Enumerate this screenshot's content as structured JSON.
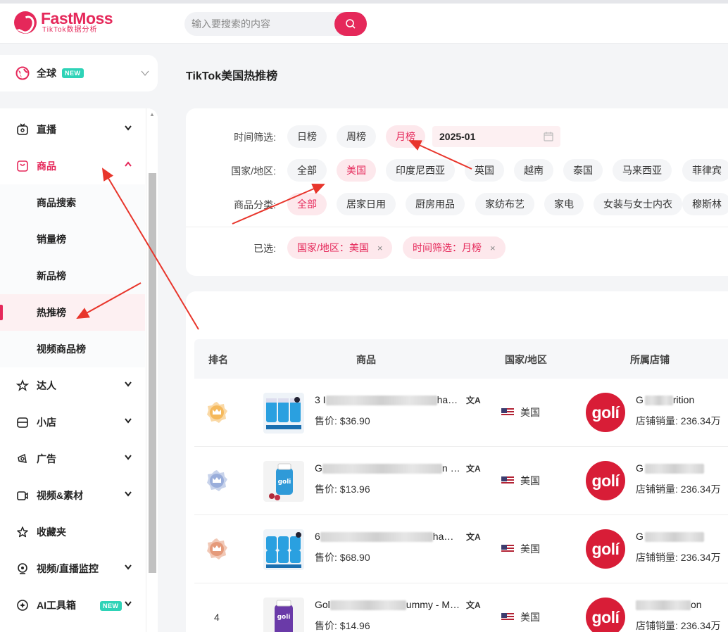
{
  "header": {
    "logo_name": "FastMoss",
    "logo_sub": "TikTok数据分析",
    "search_placeholder": "输入要搜索的内容"
  },
  "region_selector": {
    "label": "全球",
    "badge": "NEW"
  },
  "sidebar": {
    "items": [
      {
        "label": "直播",
        "icon": "live-icon"
      },
      {
        "label": "商品",
        "icon": "product-icon"
      },
      {
        "label": "达人",
        "icon": "influencer-icon"
      },
      {
        "label": "小店",
        "icon": "shop-icon"
      },
      {
        "label": "广告",
        "icon": "ad-icon"
      },
      {
        "label": "视频&素材",
        "icon": "video-icon"
      },
      {
        "label": "收藏夹",
        "icon": "star-icon"
      },
      {
        "label": "视频/直播监控",
        "icon": "monitor-icon"
      },
      {
        "label": "AI工具箱",
        "icon": "ai-icon",
        "badge": "NEW"
      }
    ],
    "sub_items": [
      "商品搜索",
      "销量榜",
      "新品榜",
      "热推榜",
      "视频商品榜"
    ]
  },
  "page_title": "TikTok美国热推榜",
  "filters": {
    "time_label": "时间筛选:",
    "time_options": [
      "日榜",
      "周榜",
      "月榜"
    ],
    "date_value": "2025-01",
    "country_label": "国家/地区:",
    "country_options": [
      "全部",
      "美国",
      "印度尼西亚",
      "英国",
      "越南",
      "泰国",
      "马来西亚",
      "菲律宾"
    ],
    "category_label": "商品分类:",
    "category_options": [
      "全部",
      "居家日用",
      "厨房用品",
      "家纺布艺",
      "家电",
      "女装与女士内衣",
      "穆斯林"
    ],
    "selected_label": "已选:",
    "selected": [
      "国家/地区：美国",
      "时间筛选：月榜"
    ],
    "remove_symbol": "×"
  },
  "table": {
    "headers": {
      "rank": "排名",
      "product": "商品",
      "country": "国家/地区",
      "shop": "所属店铺"
    },
    "price_label": "售价:",
    "sales_label": "店铺销量:",
    "rows": [
      {
        "rank": "1",
        "name_start": "3 I",
        "name_end": "ha…",
        "price": "$36.90",
        "country": "美国",
        "shop_logo": "golí",
        "shop_start": "G",
        "shop_end": "rition",
        "shop_sales": "236.34万"
      },
      {
        "rank": "2",
        "name_start": "G",
        "name_end": "n …",
        "price": "$13.96",
        "country": "美国",
        "shop_logo": "golí",
        "shop_start": "G",
        "shop_end": "",
        "shop_sales": "236.34万"
      },
      {
        "rank": "3",
        "name_start": "6",
        "name_end": "ha…",
        "price": "$68.90",
        "country": "美国",
        "shop_logo": "golí",
        "shop_start": "G",
        "shop_end": "",
        "shop_sales": "236.34万"
      },
      {
        "rank": "4",
        "name_start": "Gol",
        "name_end": "ummy - M…",
        "price": "$14.96",
        "country": "美国",
        "shop_logo": "golí",
        "shop_start": "",
        "shop_end": "on",
        "shop_sales": "236.34万"
      }
    ]
  },
  "colors": {
    "accent": "#e5285a",
    "gold": "#f5b95c",
    "silver": "#9aaedb",
    "bronze": "#e59a7a",
    "arrow": "#e8352b"
  }
}
